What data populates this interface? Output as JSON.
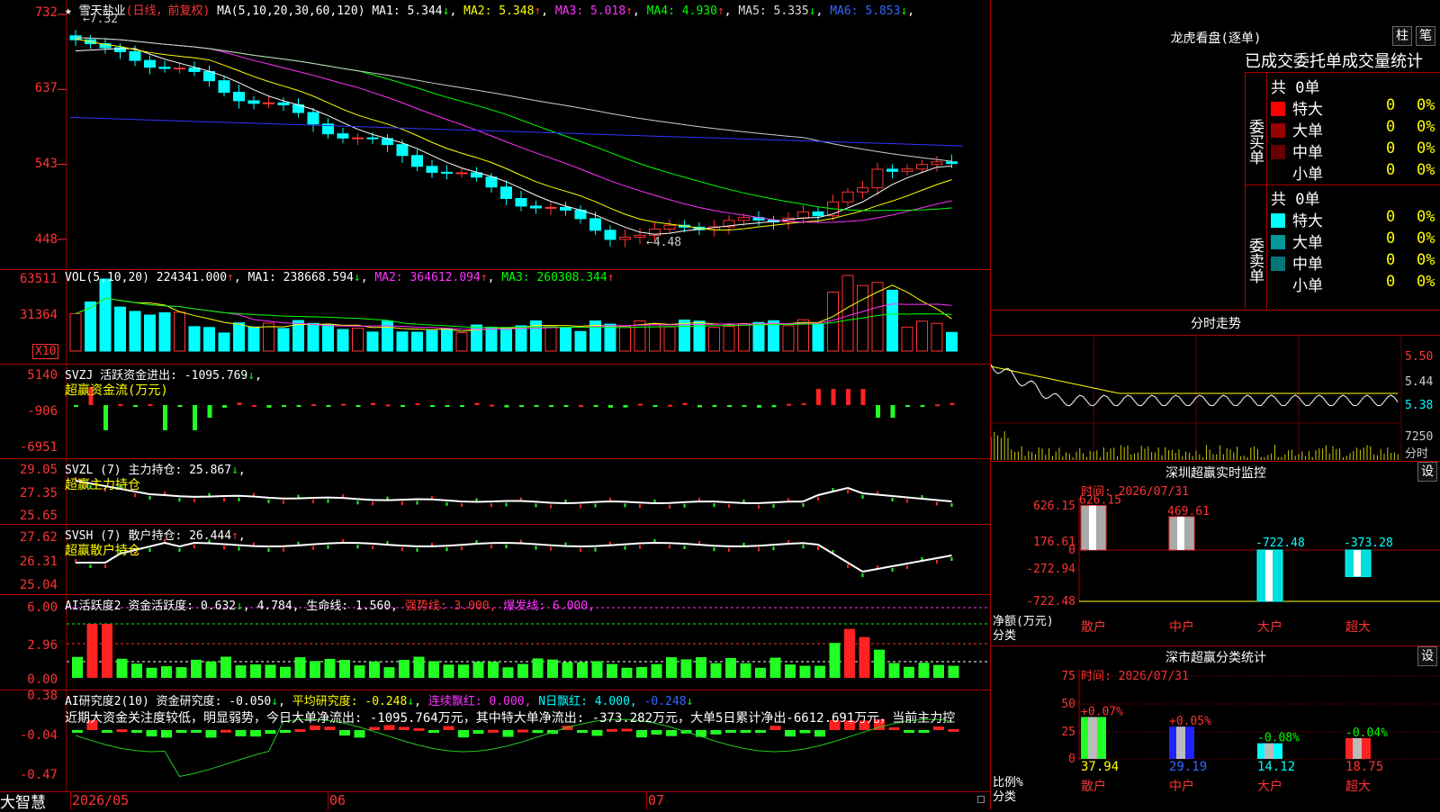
{
  "stock": {
    "star": "★",
    "name": "雪天盐业",
    "mode": "(日线，前复权)",
    "ma_label": "MA(5,10,20,30,60,120)"
  },
  "ma": [
    {
      "label": "MA1:",
      "value": "5.344",
      "arrow": "↓",
      "color": "#ffffff"
    },
    {
      "label": "MA2:",
      "value": "5.348",
      "arrow": "↑",
      "color": "#ffff00"
    },
    {
      "label": "MA3:",
      "value": "5.018",
      "arrow": "↑",
      "color": "#ff33ff"
    },
    {
      "label": "MA4:",
      "value": "4.930",
      "arrow": "↑",
      "color": "#00ff00"
    },
    {
      "label": "MA5:",
      "value": "5.335",
      "arrow": "↓",
      "color": "#dddddd"
    },
    {
      "label": "MA6:",
      "value": "5.853",
      "arrow": "↓",
      "color": "#3366ff"
    }
  ],
  "price_axis": [
    "732",
    "637",
    "543",
    "448"
  ],
  "price_hi": "←7.32",
  "price_lo": "←4.48",
  "vol": {
    "label": "VOL(5,10,20)",
    "value": "224341.000",
    "arrow": "↑",
    "ma1": "MA1: 238668.594",
    "ma1a": "↓",
    "ma2": "MA2: 364612.094",
    "ma2a": "↑",
    "ma3": "MA3: 260308.344",
    "ma3a": "↑",
    "axis": [
      "63511",
      "31364"
    ],
    "unit": "X10"
  },
  "svzj": {
    "label": "SVZJ  活跃资金进出: -1095.769",
    "arrow": "↓",
    "sub": "超赢资金流(万元)",
    "axis": [
      "5140",
      "-906",
      "-6951"
    ]
  },
  "svzl": {
    "label": "SVZL (7) 主力持仓: 25.867",
    "arrow": "↓",
    "sub": "超赢主力持仓",
    "axis": [
      "29.05",
      "27.35",
      "25.65"
    ]
  },
  "svsh": {
    "label": "SVSH (7) 散户持仓: 26.444",
    "arrow": "↑",
    "sub": "超赢散户持仓",
    "axis": [
      "27.62",
      "26.31",
      "25.04"
    ]
  },
  "ai1": {
    "label": "AI活跃度2 资金活跃度: 0.632",
    "a1": "↓",
    "v2": "4.784",
    "l3": "生命线: 1.560,",
    "l4": "强势线: 3.000,",
    "l5": "爆发线: 6.000,",
    "axis": [
      "6.00",
      "2.96",
      "0.00"
    ]
  },
  "ai2": {
    "label": "AI研究度2(10) 资金研究度: -0.050",
    "a1": "↓",
    "l2": "平均研究度: -0.248",
    "a2": "↓",
    "l3": "连续飘红: 0.000,",
    "l4": "N日飘红: 4.000,",
    "l5": "-0.248",
    "a5": "↓",
    "text": "近期大资金关注度较低，明显弱势，今日大单净流出: -1095.764万元，其中特大单净流出: -373.282万元，大单5日累计净出-6612.691万元，当前主力控",
    "axis": [
      "0.38",
      "-0.04",
      "-0.47"
    ]
  },
  "dates": [
    "2026/05",
    "06",
    "07"
  ],
  "brand": "大智慧",
  "side": {
    "title": "龙虎看盘(逐单)",
    "btn1": "柱",
    "btn2": "笔",
    "sub": "已成交委托单成交量统计",
    "buy_label": "委买单",
    "sell_label": "委卖单",
    "buy_total": "共 0单",
    "sell_total": "共 0单",
    "buy_rows": [
      {
        "name": "特大",
        "n": "0",
        "p": "0%",
        "color": "#ff0000"
      },
      {
        "name": "大单",
        "n": "0",
        "p": "0%",
        "color": "#990000"
      },
      {
        "name": "中单",
        "n": "0",
        "p": "0%",
        "color": "#660000"
      },
      {
        "name": "小单",
        "n": "0",
        "p": "0%",
        "color": "#000000"
      }
    ],
    "sell_rows": [
      {
        "name": "特大",
        "n": "0",
        "p": "0%",
        "color": "#00ffff"
      },
      {
        "name": "大单",
        "n": "0",
        "p": "0%",
        "color": "#009999"
      },
      {
        "name": "中单",
        "n": "0",
        "p": "0%",
        "color": "#007777"
      },
      {
        "name": "小单",
        "n": "0",
        "p": "0%",
        "color": "#000000"
      }
    ],
    "fs_title": "分时走势",
    "fs_axis": [
      "5.50",
      "5.44",
      "5.38"
    ],
    "fs_vol": "7250",
    "fs_unit": "分时",
    "mon_title": "深圳超赢实时监控",
    "mon_btn": "设",
    "mon_date": "时间: 2026/07/31",
    "mon_axis": [
      "626.15",
      "176.61",
      "0",
      "-272.94",
      "-722.48"
    ],
    "mon_ylab1": "净额(万元)",
    "mon_ylab2": "分类",
    "mon_bars": [
      {
        "cat": "散户",
        "val": "626.15",
        "color": "#ff3333"
      },
      {
        "cat": "中户",
        "val": "469.61",
        "color": "#ff3333"
      },
      {
        "cat": "大户",
        "val": "-722.48",
        "color": "#00ffff"
      },
      {
        "cat": "超大",
        "val": "-373.28",
        "color": "#00ffff"
      }
    ],
    "cls_title": "深市超赢分类统计",
    "cls_btn": "设",
    "cls_date": "时间: 2026/07/31",
    "cls_axis": [
      "75",
      "50",
      "25",
      "0"
    ],
    "cls_ylab1": "比例%",
    "cls_ylab2": "分类",
    "cls_bars": [
      {
        "cat": "散户",
        "pct": "+0.07%",
        "val": "37.94",
        "pctcolor": "#ff3333",
        "valcolor": "#ffff00"
      },
      {
        "cat": "中户",
        "pct": "+0.05%",
        "val": "29.19",
        "pctcolor": "#ff3333",
        "valcolor": "#3366ff"
      },
      {
        "cat": "大户",
        "pct": "-0.08%",
        "val": "14.12",
        "pctcolor": "#00ff00",
        "valcolor": "#00ffff"
      },
      {
        "cat": "超大",
        "pct": "-0.04%",
        "val": "18.75",
        "pctcolor": "#00ff00",
        "valcolor": "#ff3333"
      }
    ]
  }
}
